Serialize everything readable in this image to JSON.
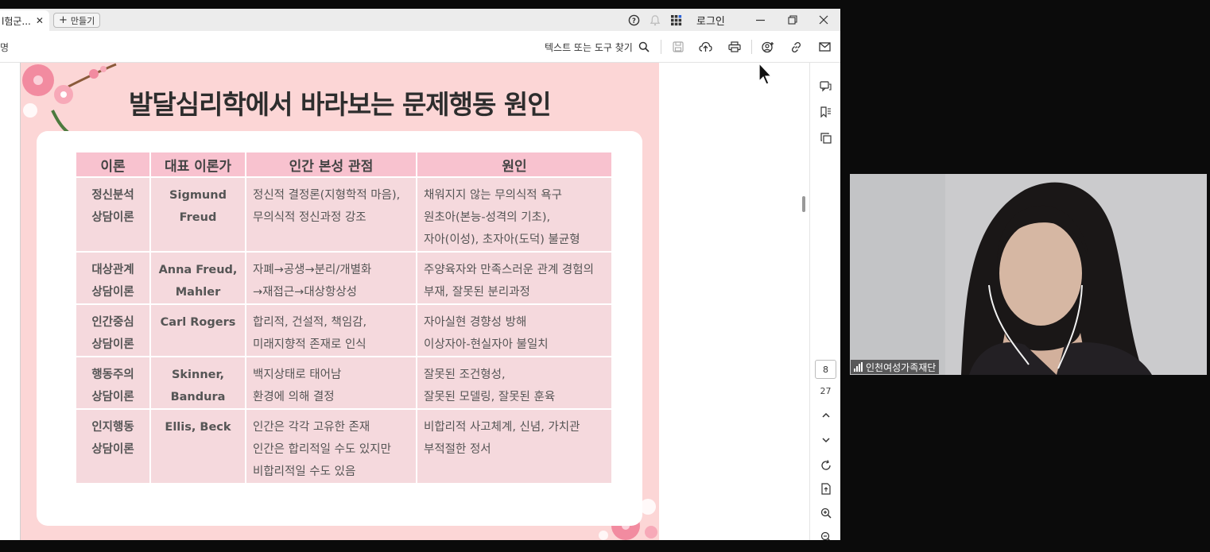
{
  "browser": {
    "tab_title": "l험군...",
    "tab_close": "✕",
    "new_tab_label": "만들기",
    "login_label": "로그인",
    "toolbar_left_text": "명",
    "search_tools_label": "텍스트 또는 도구 찾기"
  },
  "slide": {
    "title": "발달심리학에서 바라보는 문제행동 원인",
    "headers": [
      "이론",
      "대표 이론가",
      "인간 본성 관점",
      "원인"
    ],
    "rows": [
      {
        "theory": [
          "정신분석",
          "상담이론"
        ],
        "theorist": [
          "Sigmund",
          "Freud"
        ],
        "view": [
          "정신적 결정론(지형학적 마음),",
          "무의식적 정신과정 강조"
        ],
        "cause": [
          "채워지지 않는 무의식적 욕구",
          "원초아(본능-성격의 기초),",
          "자아(이성), 초자아(도덕) 불균형"
        ]
      },
      {
        "theory": [
          "대상관계",
          "상담이론"
        ],
        "theorist": [
          "Anna Freud,",
          "Mahler"
        ],
        "view": [
          "자폐→공생→분리/개별화",
          "→재접근→대상항상성"
        ],
        "cause": [
          "주양육자와 만족스러운 관계 경험의",
          "부재, 잘못된 분리과정"
        ]
      },
      {
        "theory": [
          "인간중심",
          "상담이론"
        ],
        "theorist": [
          "Carl Rogers"
        ],
        "view": [
          "합리적, 건설적, 책임감,",
          "미래지향적 존재로 인식"
        ],
        "cause": [
          "자아실현 경향성 방해",
          "이상자아-현실자아 불일치"
        ]
      },
      {
        "theory": [
          "행동주의",
          "상담이론"
        ],
        "theorist": [
          "Skinner,",
          "Bandura"
        ],
        "view": [
          "백지상태로 태어남",
          "환경에 의해 결정"
        ],
        "cause": [
          "잘못된 조건형성,",
          "잘못된 모델링, 잘못된 훈육"
        ]
      },
      {
        "theory": [
          "인지행동",
          "상담이론"
        ],
        "theorist": [
          "Ellis, Beck"
        ],
        "view": [
          "인간은 각각 고유한 존재",
          "인간은 합리적일 수도 있지만",
          "비합리적일 수도 있음"
        ],
        "cause": [
          "비합리적 사고체계, 신념, 가치관",
          "부적절한 정서"
        ]
      }
    ]
  },
  "viewer": {
    "current_page": "8",
    "total_pages": "27"
  },
  "video": {
    "participant_name": "인천여성가족재단"
  },
  "colors": {
    "slide_bg": "#fcd6d6",
    "header_cell": "#f8c2cf",
    "body_cell": "#f5d9dd",
    "title_text": "#2d2d2d"
  }
}
